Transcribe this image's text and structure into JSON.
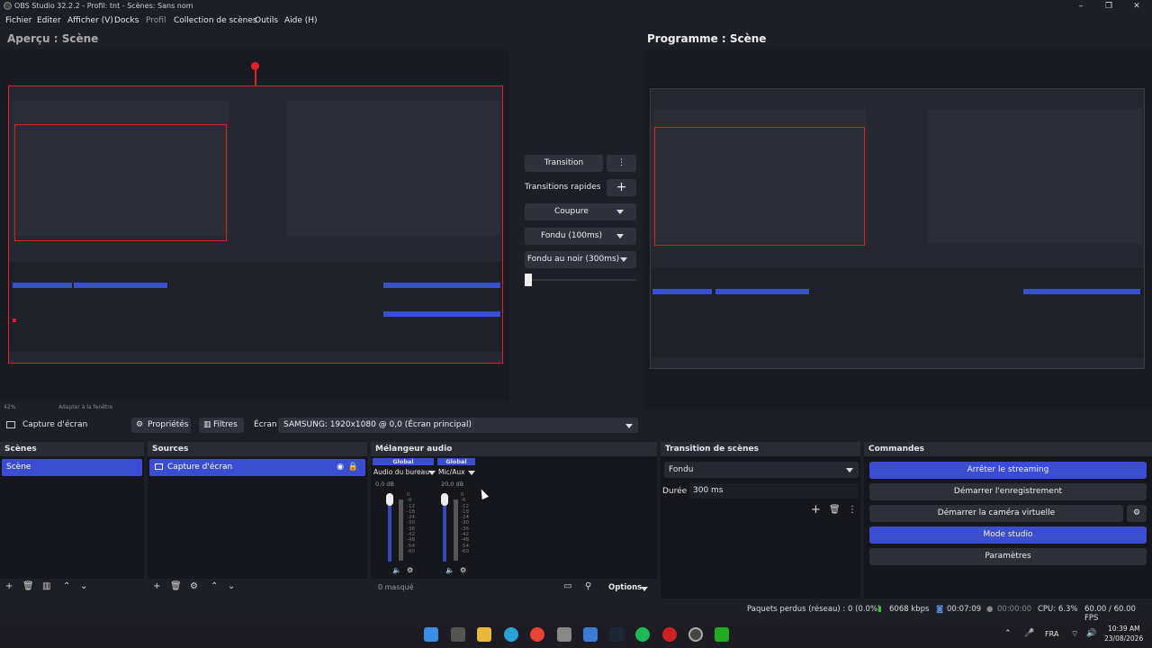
{
  "window": {
    "title": "OBS Studio 32.2.2 - Profil: tnt - Scènes: Sans nom",
    "controls": [
      "–",
      "❐",
      "✕"
    ]
  },
  "menu": [
    "Fichier",
    "Editer",
    "Afficher (V)",
    "Docks",
    "Profil",
    "Collection de scènes",
    "Outils",
    "Aide (H)"
  ],
  "preview": {
    "title": "Aperçu : Scène",
    "zoom": "42%",
    "fit": "Adapter à la fenêtre"
  },
  "program": {
    "title": "Programme : Scène"
  },
  "transition_panel": {
    "transition": "Transition",
    "quick": "Transitions rapides",
    "cut": "Coupure",
    "fade": "Fondu (100ms)",
    "fade_black": "Fondu au noir (300ms)"
  },
  "source_toolbar": {
    "source_name": "Capture d'écran",
    "properties": "Propriétés",
    "filters": "Filtres",
    "screen_label": "Écran",
    "screen_value": "SAMSUNG: 1920x1080 @ 0,0 (Écran principal)"
  },
  "scenes": {
    "title": "Scènes",
    "items": [
      "Scène"
    ]
  },
  "sources": {
    "title": "Sources",
    "items": [
      "Capture d'écran"
    ]
  },
  "mixer": {
    "title": "Mélangeur audio",
    "channels": [
      {
        "scope": "Global",
        "name": "Audio du bureau",
        "db": "0.0 dB",
        "level": 0.85
      },
      {
        "scope": "Global",
        "name": "Mic/Aux",
        "db": "20.0 dB",
        "level": 0.85
      }
    ],
    "scale": [
      "0",
      "-6",
      "-12",
      "-18",
      "-24",
      "-30",
      "-36",
      "-42",
      "-48",
      "-54",
      "-60"
    ],
    "hidden": "0 masqué",
    "options": "Options"
  },
  "scene_transition": {
    "title": "Transition de scènes",
    "type": "Fondu",
    "duration_label": "Durée",
    "duration_value": "300 ms"
  },
  "commands": {
    "title": "Commandes",
    "stop_stream": "Arrêter le streaming",
    "start_record": "Démarrer l'enregistrement",
    "virtual_cam": "Démarrer la caméra virtuelle",
    "studio_mode": "Mode studio",
    "settings": "Paramètres"
  },
  "status": {
    "dropped": "Paquets perdus (réseau) : 0 (0.0%)",
    "bitrate": "6068 kbps",
    "stream_time": "00:07:09",
    "rec_time": "00:00:00",
    "cpu": "CPU: 6.3%",
    "fps": "60.00 / 60.00 FPS"
  },
  "taskbar": {
    "lang": "FRA",
    "time": "10:39 AM",
    "date": "23/08/2026"
  },
  "colors": {
    "accent": "#3b4dd3",
    "red": "#e0202f",
    "bg": "#1d1f26"
  }
}
